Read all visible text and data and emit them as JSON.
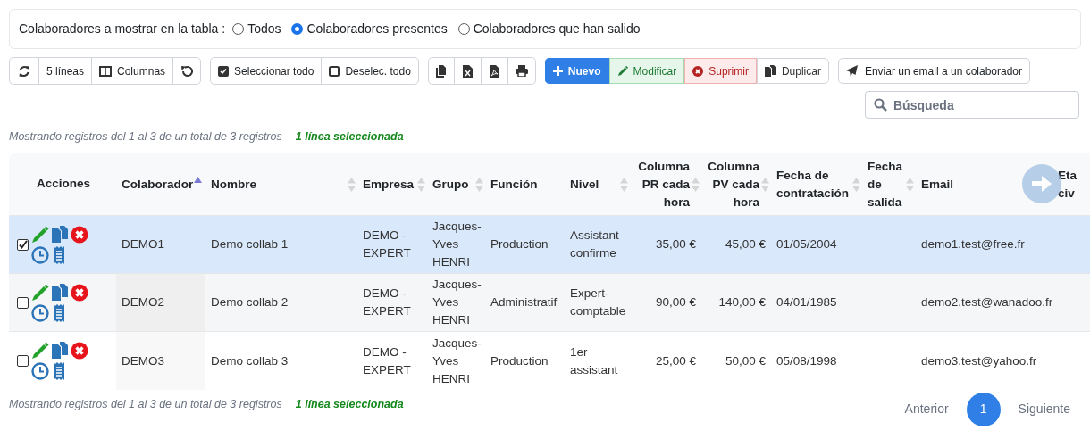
{
  "filter": {
    "label": "Colaboradores a mostrar en la tabla :",
    "options": [
      {
        "label": "Todos",
        "selected": false
      },
      {
        "label": "Colaboradores presentes",
        "selected": true
      },
      {
        "label": "Colaboradores que han salido",
        "selected": false
      }
    ]
  },
  "toolbar": {
    "lines": "5 líneas",
    "columns": "Columnas",
    "select_all": "Seleccionar todo",
    "deselect_all": "Deselec. todo",
    "actions": [
      {
        "label": "Nuevo",
        "kind": "primary"
      },
      {
        "label": "Modificar",
        "kind": "success"
      },
      {
        "label": "Suprimir",
        "kind": "danger"
      },
      {
        "label": "Duplicar",
        "kind": "default"
      }
    ],
    "email": "Enviar un email a un colaborador"
  },
  "search": {
    "placeholder": "Búsqueda"
  },
  "info_top": {
    "text": "Mostrando registros del 1 al 3 de un total de 3 registros",
    "selection": "1 línea seleccionada"
  },
  "table": {
    "actions_header": "Acciones",
    "columns": [
      {
        "label": "Colaborador",
        "sorted": true
      },
      {
        "label": "Nombre",
        "sortable": true,
        "sorted": false
      },
      {
        "label": "Empresa",
        "sortable": true,
        "sorted": false
      },
      {
        "label": "Grupo",
        "sortable": true,
        "sorted": false
      },
      {
        "label": "Función",
        "sortable": false,
        "sorted": false
      },
      {
        "label": "Nivel",
        "sortable": true,
        "sorted": false
      },
      {
        "label": "Columna PR cada hora",
        "sortable": true,
        "sorted": false
      },
      {
        "label": "Columna PV cada hora",
        "sortable": true,
        "sorted": false
      },
      {
        "label": "Fecha de contratación",
        "sortable": true,
        "sorted": false
      },
      {
        "label": "Fecha de salida",
        "sortable": true,
        "sorted": false
      },
      {
        "label": "Email"
      },
      {
        "label": "Eta civ"
      }
    ],
    "rows": [
      {
        "selected": true,
        "cells": [
          "DEMO1",
          "Demo collab 1",
          "DEMO - EXPERT",
          "Jacques-Yves HENRI",
          "Production",
          "Assistant confirme",
          "35,00 €",
          "45,00 €",
          "01/05/2004",
          "",
          "demo1.test@free.fr"
        ]
      },
      {
        "selected": false,
        "cells": [
          "DEMO2",
          "Demo collab 2",
          "DEMO - EXPERT",
          "Jacques-Yves HENRI",
          "Administratif",
          "Expert-comptable",
          "90,00 €",
          "140,00 €",
          "04/01/1985",
          "",
          "demo2.test@wanadoo.fr"
        ]
      },
      {
        "selected": false,
        "cells": [
          "DEMO3",
          "Demo collab 3",
          "DEMO - EXPERT",
          "Jacques-Yves HENRI",
          "Production",
          "1er assistant",
          "25,00 €",
          "50,00 €",
          "05/08/1998",
          "",
          "demo3.test@yahoo.fr"
        ]
      }
    ]
  },
  "info_bottom": {
    "text": "Mostrando registros del 1 al 3 de un total de 3 registros",
    "selection": "1 línea seleccionada"
  },
  "pagination": {
    "previous": "Anterior",
    "pages": [
      {
        "label": "1",
        "selected": true
      }
    ],
    "next": "Siguiente"
  }
}
